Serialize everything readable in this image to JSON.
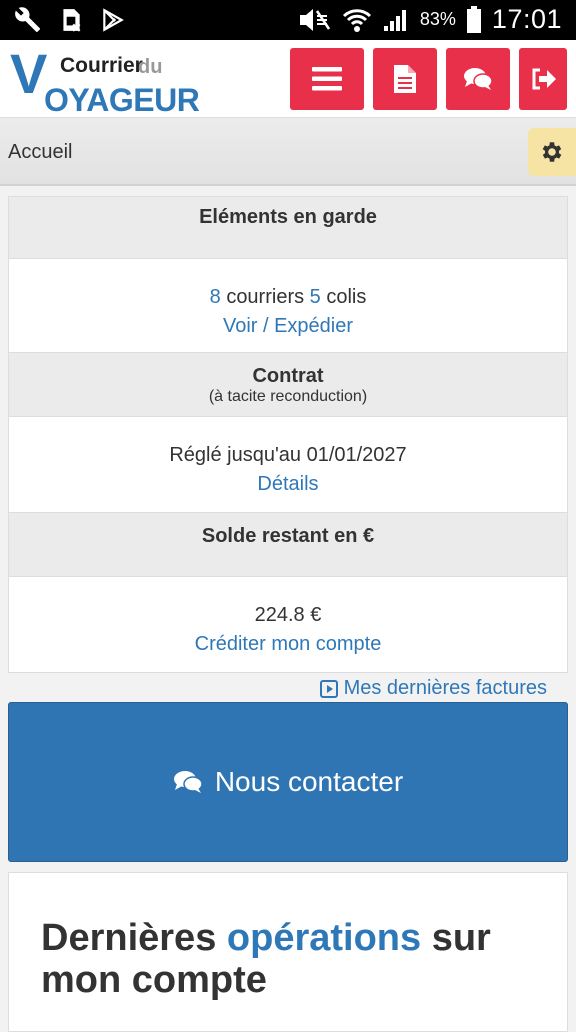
{
  "status_bar": {
    "battery_percent": "83%",
    "time": "17:01",
    "left_icons": [
      "wrench-icon",
      "sim-blocked-icon",
      "play-store-icon"
    ],
    "right_icons": [
      "mute-icon",
      "wifi-icon",
      "signal-icon",
      "battery-icon"
    ]
  },
  "header": {
    "logo": {
      "v": "V",
      "courrier": "Courrier",
      "du": "du",
      "voyageur": "OYAGEUR"
    },
    "buttons": [
      {
        "icon": "menu-icon"
      },
      {
        "icon": "document-icon"
      },
      {
        "icon": "chat-icon"
      },
      {
        "icon": "logout-icon"
      }
    ],
    "accent": "#e8304a"
  },
  "breadcrumb": {
    "label": "Accueil",
    "settings_icon": "gear-icon"
  },
  "panel": {
    "elements": {
      "title": "Eléments en garde",
      "courriers_count": "8",
      "courriers_label": "courriers",
      "colis_count": "5",
      "colis_label": "colis",
      "link": "Voir / Expédier"
    },
    "contrat": {
      "title": "Contrat",
      "subtitle": "(à tacite reconduction)",
      "text": "Réglé jusqu'au 01/01/2027",
      "link": "Détails"
    },
    "solde": {
      "title": "Solde restant en €",
      "amount": "224.8 €",
      "link": "Créditer mon compte"
    }
  },
  "factures_link": "Mes dernières factures",
  "contact_button": "Nous contacter",
  "operations": {
    "title_part1": "Dernières ",
    "title_highlight": "opérations",
    "title_part2": " sur mon compte"
  },
  "colors": {
    "link": "#2f78b8",
    "primary_button": "#2f75b3",
    "settings_bg": "#f6e4a5"
  }
}
